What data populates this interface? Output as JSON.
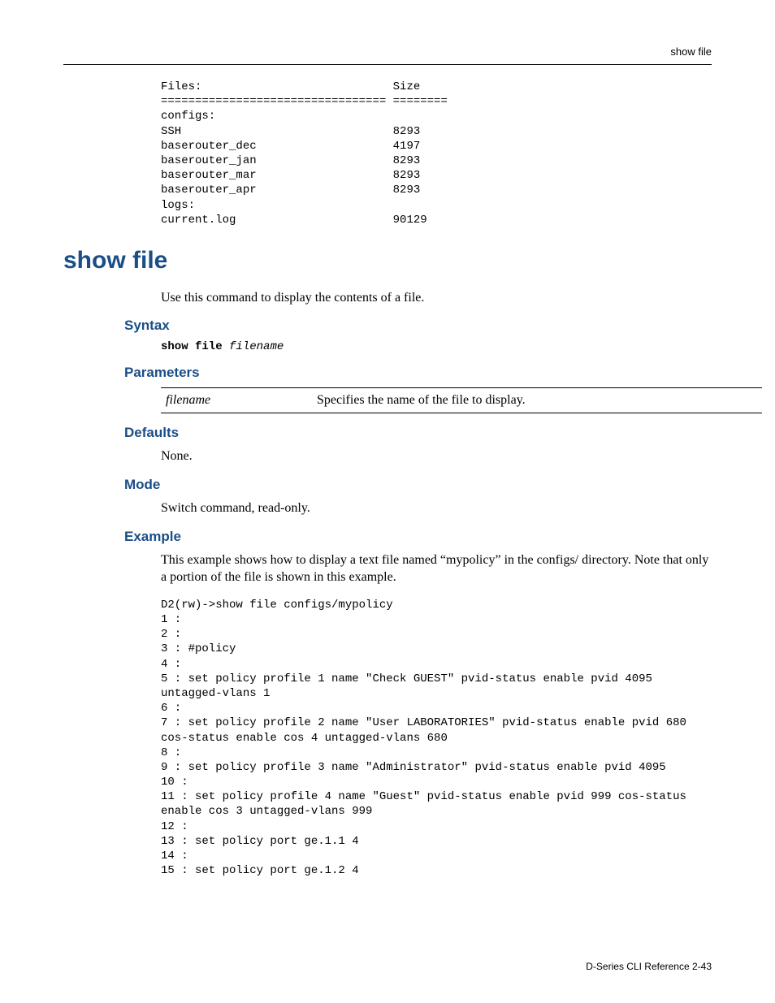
{
  "header": {
    "crumb": "show file"
  },
  "files_block": "Files:                            Size\n================================= ========\nconfigs:\nSSH                               8293\nbaserouter_dec                    4197\nbaserouter_jan                    8293\nbaserouter_mar                    8293\nbaserouter_apr                    8293\nlogs:\ncurrent.log                       90129",
  "command_title": "show file",
  "intro": "Use this command to display the contents of a file.",
  "sections": {
    "syntax": {
      "label": "Syntax",
      "cmd_kw": "show file",
      "cmd_arg": "filename"
    },
    "parameters": {
      "label": "Parameters",
      "rows": [
        {
          "name": "filename",
          "desc": "Specifies the name of the file to display."
        }
      ]
    },
    "defaults": {
      "label": "Defaults",
      "text": "None."
    },
    "mode": {
      "label": "Mode",
      "text": "Switch command, read-only."
    },
    "example": {
      "label": "Example",
      "intro": "This example shows how to display a text file named “mypolicy” in the configs/ directory. Note that only a portion of the file is shown in this example.",
      "output": "D2(rw)->show file configs/mypolicy\n1 :\n2 :\n3 : #policy\n4 :\n5 : set policy profile 1 name \"Check GUEST\" pvid-status enable pvid 4095 untagged-vlans 1\n6 :\n7 : set policy profile 2 name \"User LABORATORIES\" pvid-status enable pvid 680 cos-status enable cos 4 untagged-vlans 680\n8 :\n9 : set policy profile 3 name \"Administrator\" pvid-status enable pvid 4095\n10 :\n11 : set policy profile 4 name \"Guest\" pvid-status enable pvid 999 cos-status enable cos 3 untagged-vlans 999\n12 :\n13 : set policy port ge.1.1 4\n14 :\n15 : set policy port ge.1.2 4"
    }
  },
  "footer": {
    "text": "D-Series CLI Reference   2-43"
  }
}
